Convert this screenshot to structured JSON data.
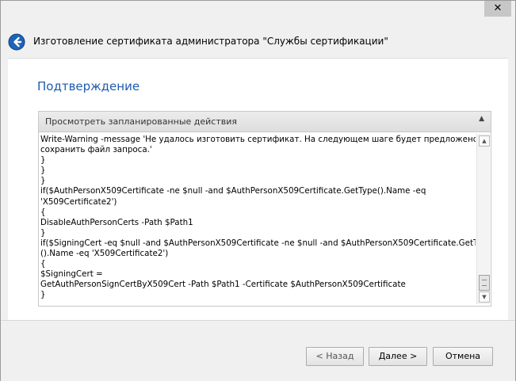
{
  "window": {
    "close_label": "✕"
  },
  "header": {
    "title": "Изготовление сертификата администратора \"Службы сертификации\""
  },
  "page": {
    "title": "Подтверждение"
  },
  "expander": {
    "header_label": "Просмотреть запланированные действия",
    "collapse_glyph": "▲",
    "lines": [
      "Write-Warning -message 'Не удалось изготовить сертификат. На следующем шаге будет предложено",
      "сохранить файл запроса.'",
      "}",
      "}",
      "}",
      "if($AuthPersonX509Certificate -ne $null -and $AuthPersonX509Certificate.GetType().Name -eq",
      "'X509Certificate2')",
      "{",
      "DisableAuthPersonCerts -Path $Path1",
      "}",
      "if($SigningCert -eq $null -and $AuthPersonX509Certificate -ne $null -and $AuthPersonX509Certificate.GetType",
      "().Name -eq 'X509Certificate2')",
      "{",
      "$SigningCert =",
      "GetAuthPersonSignCertByX509Cert -Path $Path1 -Certificate $AuthPersonX509Certificate",
      "}"
    ]
  },
  "scrollbar": {
    "up_glyph": "▲",
    "down_glyph": "▼"
  },
  "footer": {
    "back_label": "< Назад",
    "next_label": "Далее >",
    "cancel_label": "Отмена"
  },
  "icons": {
    "back": "back-arrow-icon"
  },
  "colors": {
    "title_blue": "#1f5bb0",
    "back_icon_blue": "#1e63b8"
  }
}
